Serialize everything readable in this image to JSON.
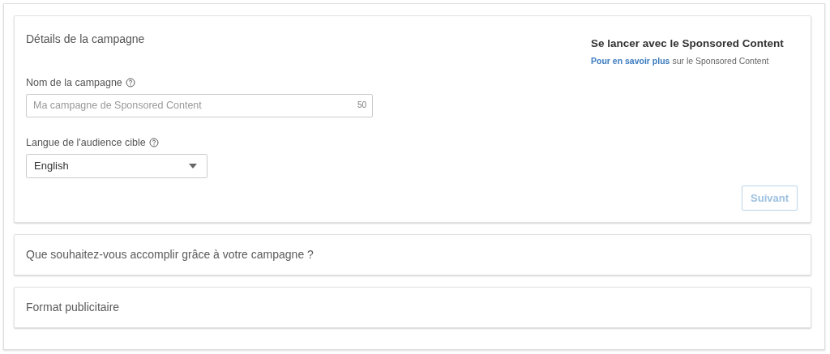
{
  "campaign_details": {
    "title": "Détails de la campagne",
    "name_field": {
      "label": "Nom de la campagne",
      "placeholder": "Ma campagne de Sponsored Content",
      "counter": "50"
    },
    "language_field": {
      "label": "Langue de l'audience cible",
      "value": "English"
    },
    "sidebar": {
      "title": "Se lancer avec le Sponsored Content",
      "link": "Pour en savoir plus",
      "text": "sur le Sponsored Content"
    },
    "next_button": {
      "label": "Suivant",
      "disabled": true
    }
  },
  "sections": [
    {
      "title": "Que souhaitez-vous accomplir grâce à votre campagne ?"
    },
    {
      "title": "Format publicitaire"
    }
  ]
}
